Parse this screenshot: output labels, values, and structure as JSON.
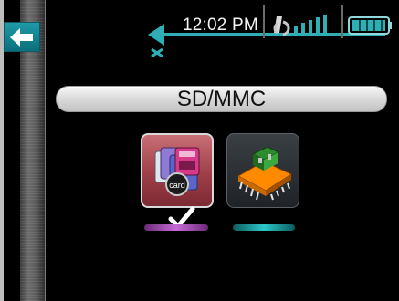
{
  "status_bar": {
    "time": "12:02 PM",
    "signal_icon": "signal-icon",
    "battery_icon": "battery-icon"
  },
  "navigation": {
    "back_icon": "back-arrow-icon"
  },
  "mode_banner": {
    "label": "SD/MMC"
  },
  "modes": [
    {
      "name": "card-mode",
      "icon": "memory-card-icon",
      "overlay_label": "card",
      "selected": true
    },
    {
      "name": "chip-mode",
      "icon": "chip-icon",
      "selected": false
    }
  ],
  "colors": {
    "back_button": "#0b6f7c",
    "card_tile": "#9e3e48",
    "selected_underline": "#c66bd6",
    "unselected_underline": "#2bc7c7",
    "status_arrow": "#30aeb6"
  }
}
